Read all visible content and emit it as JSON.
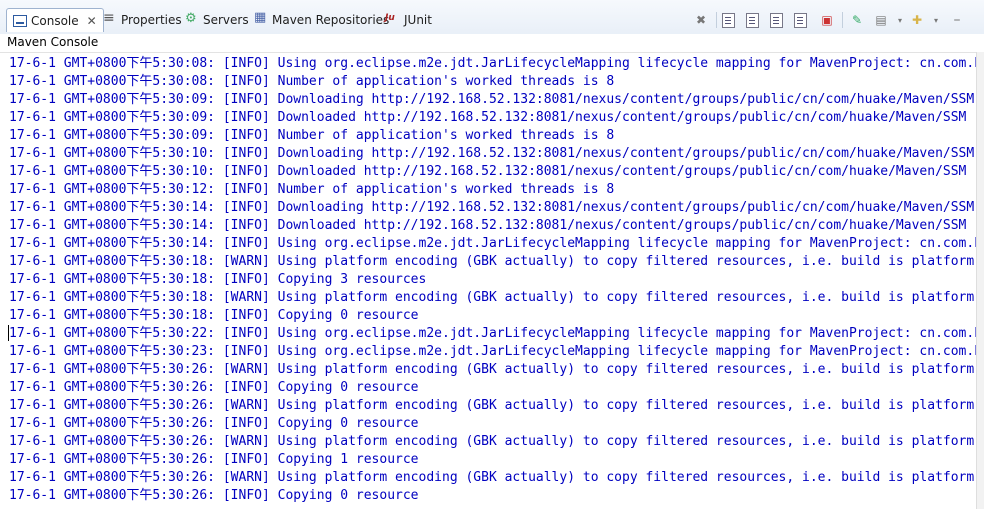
{
  "tabs": [
    {
      "label": "Console",
      "icon": "console-icon",
      "active": true,
      "close": "✕"
    },
    {
      "label": "Properties",
      "icon": "properties-icon"
    },
    {
      "label": "Servers",
      "icon": "servers-icon"
    },
    {
      "label": "Maven Repositories",
      "icon": "maven-repositories-icon"
    },
    {
      "label": "JUnit",
      "icon": "junit-icon"
    }
  ],
  "console_title": "Maven Console",
  "colors": {
    "text": "#0000c0",
    "tab_bar": "#e7eef7"
  },
  "lines": [
    "17-6-1 GMT+0800下午5:30:08: [INFO] Using org.eclipse.m2e.jdt.JarLifecycleMapping lifecycle mapping for MavenProject: cn.com.huake",
    "17-6-1 GMT+0800下午5:30:08: [INFO] Number of application's worked threads is 8",
    "17-6-1 GMT+0800下午5:30:09: [INFO] Downloading http://192.168.52.132:8081/nexus/content/groups/public/cn/com/huake/Maven/SSM",
    "17-6-1 GMT+0800下午5:30:09: [INFO] Downloaded http://192.168.52.132:8081/nexus/content/groups/public/cn/com/huake/Maven/SSM",
    "17-6-1 GMT+0800下午5:30:09: [INFO] Number of application's worked threads is 8",
    "17-6-1 GMT+0800下午5:30:10: [INFO] Downloading http://192.168.52.132:8081/nexus/content/groups/public/cn/com/huake/Maven/SSM",
    "17-6-1 GMT+0800下午5:30:10: [INFO] Downloaded http://192.168.52.132:8081/nexus/content/groups/public/cn/com/huake/Maven/SSM",
    "17-6-1 GMT+0800下午5:30:12: [INFO] Number of application's worked threads is 8",
    "17-6-1 GMT+0800下午5:30:14: [INFO] Downloading http://192.168.52.132:8081/nexus/content/groups/public/cn/com/huake/Maven/SSM",
    "17-6-1 GMT+0800下午5:30:14: [INFO] Downloaded http://192.168.52.132:8081/nexus/content/groups/public/cn/com/huake/Maven/SSM",
    "17-6-1 GMT+0800下午5:30:14: [INFO] Using org.eclipse.m2e.jdt.JarLifecycleMapping lifecycle mapping for MavenProject: cn.com.huake",
    "17-6-1 GMT+0800下午5:30:18: [WARN] Using platform encoding (GBK actually) to copy filtered resources, i.e. build is platform",
    "17-6-1 GMT+0800下午5:30:18: [INFO] Copying 3 resources",
    "17-6-1 GMT+0800下午5:30:18: [WARN] Using platform encoding (GBK actually) to copy filtered resources, i.e. build is platform",
    "17-6-1 GMT+0800下午5:30:18: [INFO] Copying 0 resource",
    "17-6-1 GMT+0800下午5:30:22: [INFO] Using org.eclipse.m2e.jdt.JarLifecycleMapping lifecycle mapping for MavenProject: cn.com.huake",
    "17-6-1 GMT+0800下午5:30:23: [INFO] Using org.eclipse.m2e.jdt.JarLifecycleMapping lifecycle mapping for MavenProject: cn.com.huake",
    "17-6-1 GMT+0800下午5:30:26: [WARN] Using platform encoding (GBK actually) to copy filtered resources, i.e. build is platform",
    "17-6-1 GMT+0800下午5:30:26: [INFO] Copying 0 resource",
    "17-6-1 GMT+0800下午5:30:26: [WARN] Using platform encoding (GBK actually) to copy filtered resources, i.e. build is platform",
    "17-6-1 GMT+0800下午5:30:26: [INFO] Copying 0 resource",
    "17-6-1 GMT+0800下午5:30:26: [WARN] Using platform encoding (GBK actually) to copy filtered resources, i.e. build is platform",
    "17-6-1 GMT+0800下午5:30:26: [INFO] Copying 1 resource",
    "17-6-1 GMT+0800下午5:30:26: [WARN] Using platform encoding (GBK actually) to copy filtered resources, i.e. build is platform",
    "17-6-1 GMT+0800下午5:30:26: [INFO] Copying 0 resource"
  ]
}
